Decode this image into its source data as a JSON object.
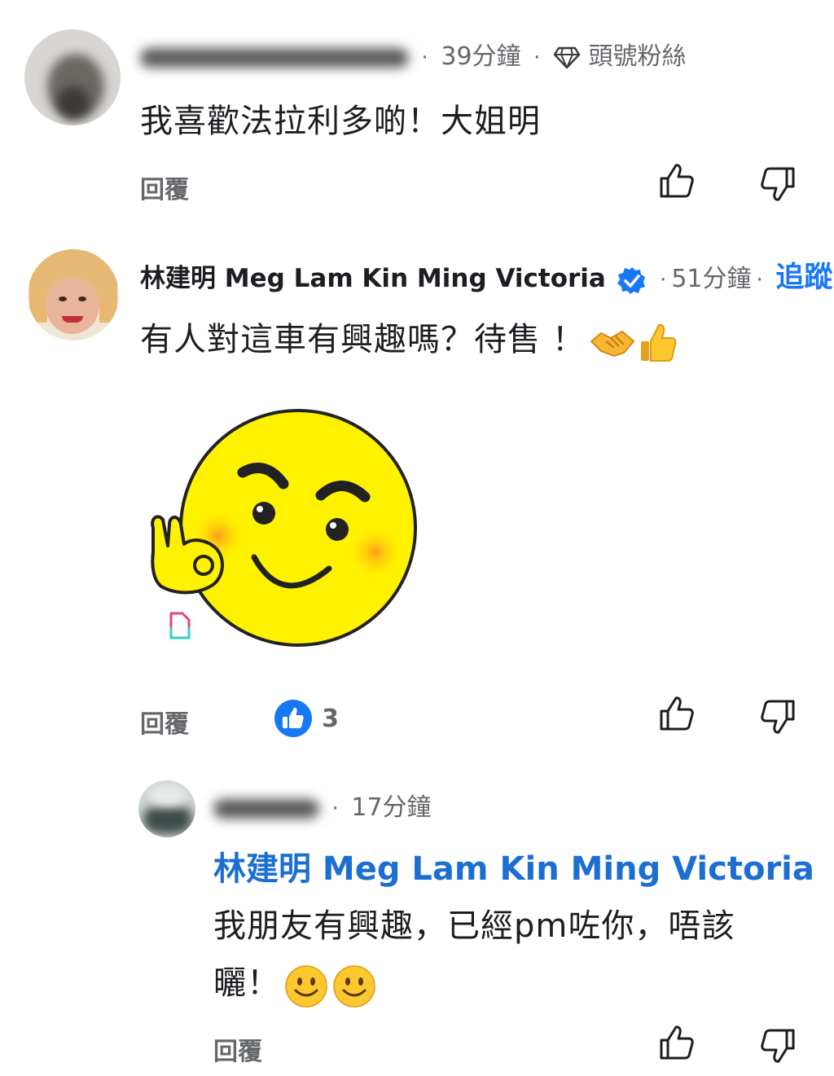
{
  "comments": [
    {
      "author_obscured": true,
      "time": "39分鐘",
      "badge_icon": "diamond-icon",
      "badge_label": "頭號粉絲",
      "text": "我喜歡法拉利多啲！大姐明",
      "reply_label": "回覆"
    },
    {
      "author": "林建明 Meg Lam Kin Ming Victoria",
      "verified": true,
      "time": "51分鐘",
      "follow_label": "追蹤",
      "text": "有人對這車有興趣嗎？待售 ！",
      "text_emojis": [
        "handshake-emoji",
        "thumbs-up-emoji"
      ],
      "sticker": "smiley-ok-hand-sticker",
      "reply_label": "回覆",
      "reaction_icon": "like-reaction-icon",
      "reaction_count": "3"
    },
    {
      "author_obscured": true,
      "time": "17分鐘",
      "mention": "林建明 Meg Lam Kin Ming Victoria",
      "text_line1": "我朋友有興趣，已經pm咗你，唔該",
      "text_line2": "曬！",
      "text_emojis": [
        "smiling-face-emoji",
        "smiling-face-emoji"
      ],
      "reply_label": "回覆"
    }
  ],
  "colors": {
    "accent": "#1877f2",
    "mention": "#1c6fd1",
    "muted_text": "#65676b",
    "sticker_yellow": "#fff200"
  }
}
